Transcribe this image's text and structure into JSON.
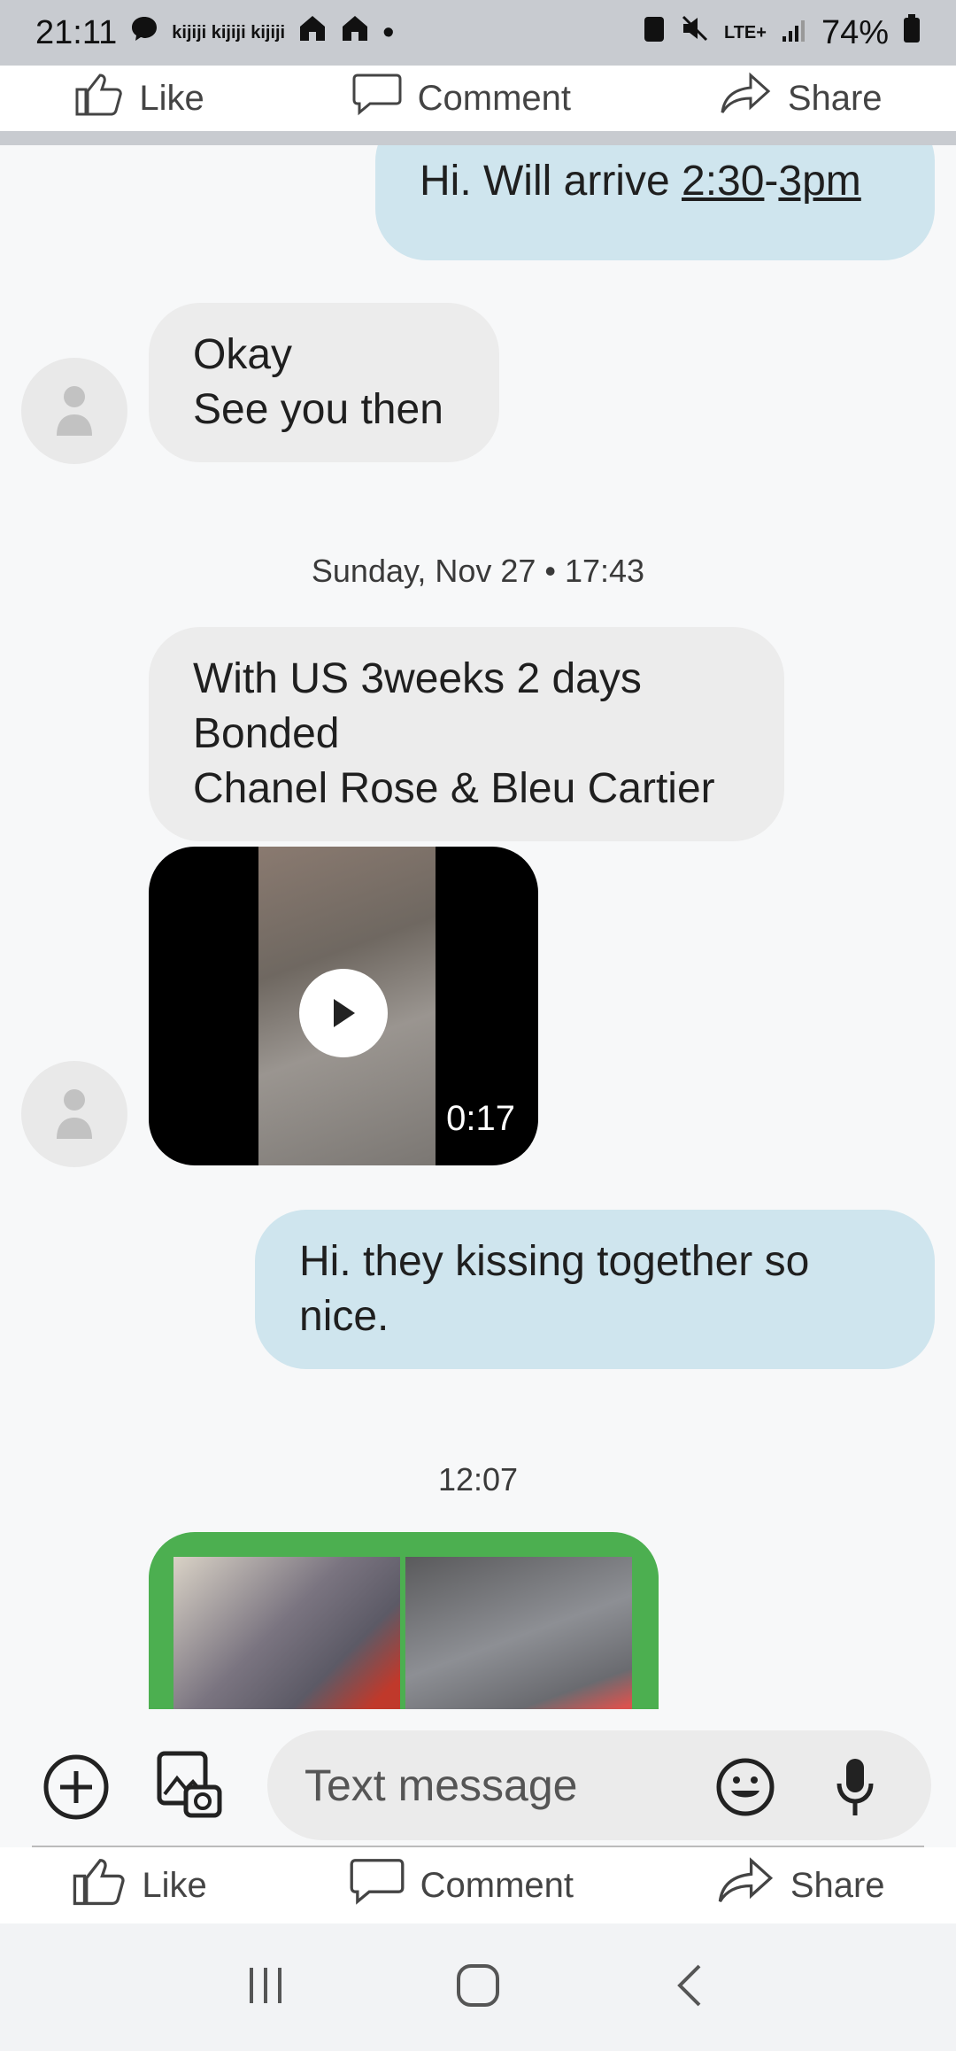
{
  "status": {
    "time": "21:11",
    "notif_text": "kijiji kijiji kijiji",
    "network": "LTE+",
    "battery": "74%"
  },
  "top_actions": {
    "like": "Like",
    "comment": "Comment",
    "share": "Share"
  },
  "messages": [
    {
      "side": "out",
      "text_pre": "Hi. Will arrive ",
      "time_a": "2:30",
      "dash": "-",
      "time_b": "3pm"
    },
    {
      "side": "in",
      "line1": "Okay",
      "line2": "See you then"
    },
    {
      "date": "Sunday, Nov 27 • 17:43"
    },
    {
      "side": "in",
      "line1": "With US 3weeks 2 days",
      "line2": "Bonded",
      "line3": "Chanel Rose & Bleu Cartier"
    },
    {
      "video_duration": "0:17"
    },
    {
      "side": "out",
      "line1": "Hi. they kissing together so",
      "line2": "nice."
    },
    {
      "date": "12:07"
    }
  ],
  "compose": {
    "placeholder": "Text message"
  },
  "bottom_actions": {
    "like": "Like",
    "comment": "Comment",
    "share": "Share"
  },
  "colors": {
    "incoming": "#ececec",
    "outgoing": "#cfe5ee",
    "photo_frame": "#4caf50"
  }
}
